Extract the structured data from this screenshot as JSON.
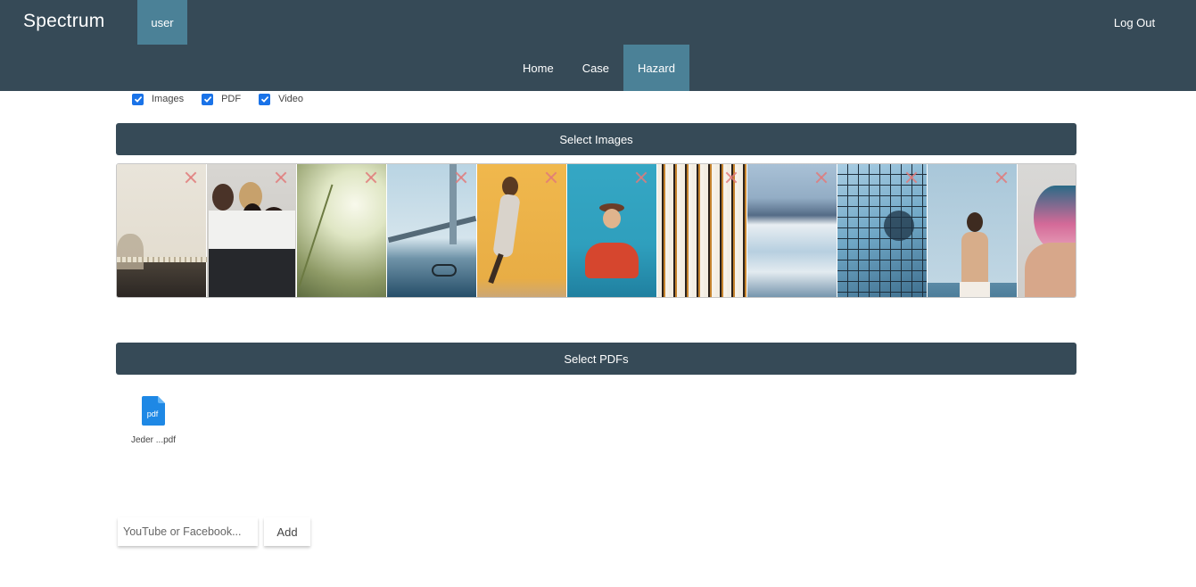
{
  "header": {
    "brand": "Spectrum",
    "user_tab": "user",
    "logout": "Log Out",
    "nav": [
      {
        "label": "Home",
        "active": false
      },
      {
        "label": "Case",
        "active": false
      },
      {
        "label": "Hazard",
        "active": true
      }
    ]
  },
  "filters": [
    {
      "label": "Images",
      "checked": true
    },
    {
      "label": "PDF",
      "checked": true
    },
    {
      "label": "Video",
      "checked": true
    }
  ],
  "images_section": {
    "button_label": "Select Images",
    "thumbnails": [
      {
        "subject": "beige wall with lace and shadow"
      },
      {
        "subject": "four women posing together"
      },
      {
        "subject": "grass stalk against bright light"
      },
      {
        "subject": "bridge with bicycle on pier"
      },
      {
        "subject": "woman in sequin dress against yellow wall"
      },
      {
        "subject": "woman in hat against teal wall"
      },
      {
        "subject": "abstract birch pattern"
      },
      {
        "subject": "white travertine terraces"
      },
      {
        "subject": "grid window with blue reflection"
      },
      {
        "subject": "woman with arms raised by the sea"
      },
      {
        "subject": "woman with pink hair"
      }
    ]
  },
  "pdfs_section": {
    "button_label": "Select PDFs",
    "files": [
      {
        "name": "Jeder ...pdf",
        "icon_text": "pdf"
      }
    ]
  },
  "video_input": {
    "placeholder": "YouTube or Facebook...",
    "value": "",
    "add_label": "Add"
  },
  "colors": {
    "header_bg": "#364a57",
    "active_tab": "#4b8197",
    "checkbox": "#1a73e8",
    "remove_x": "#e07a7a",
    "pdf_icon": "#1e88e5"
  }
}
